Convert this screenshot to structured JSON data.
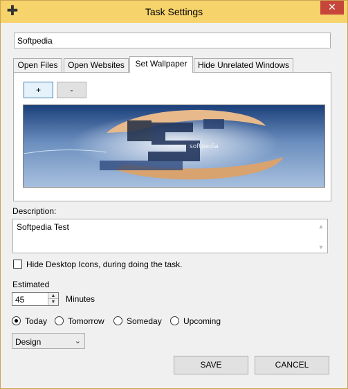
{
  "window": {
    "title": "Task Settings",
    "close_glyph": "✕",
    "system_icon": "pin-icon"
  },
  "task_name": {
    "value": "Softpedia"
  },
  "tabs": [
    {
      "label": "Open Files"
    },
    {
      "label": "Open Websites"
    },
    {
      "label": "Set Wallpaper"
    },
    {
      "label": "Hide Unrelated Windows"
    }
  ],
  "active_tab": "Set Wallpaper",
  "wallpaper_panel": {
    "add_label": "+",
    "remove_label": "-"
  },
  "description": {
    "label": "Description:",
    "value": "Softpedia Test"
  },
  "hide_icons": {
    "label": "Hide Desktop Icons, during doing the task.",
    "checked": false
  },
  "estimated": {
    "label": "Estimated",
    "value": "45",
    "unit": "Minutes"
  },
  "schedule": {
    "options": [
      "Today",
      "Tomorrow",
      "Someday",
      "Upcoming"
    ],
    "selected": "Today"
  },
  "category": {
    "value": "Design"
  },
  "actions": {
    "save_label": "SAVE",
    "cancel_label": "CANCEL"
  },
  "colors": {
    "titlebar": "#f6d36b",
    "close": "#c7463a",
    "panel": "#f0f0f0"
  }
}
